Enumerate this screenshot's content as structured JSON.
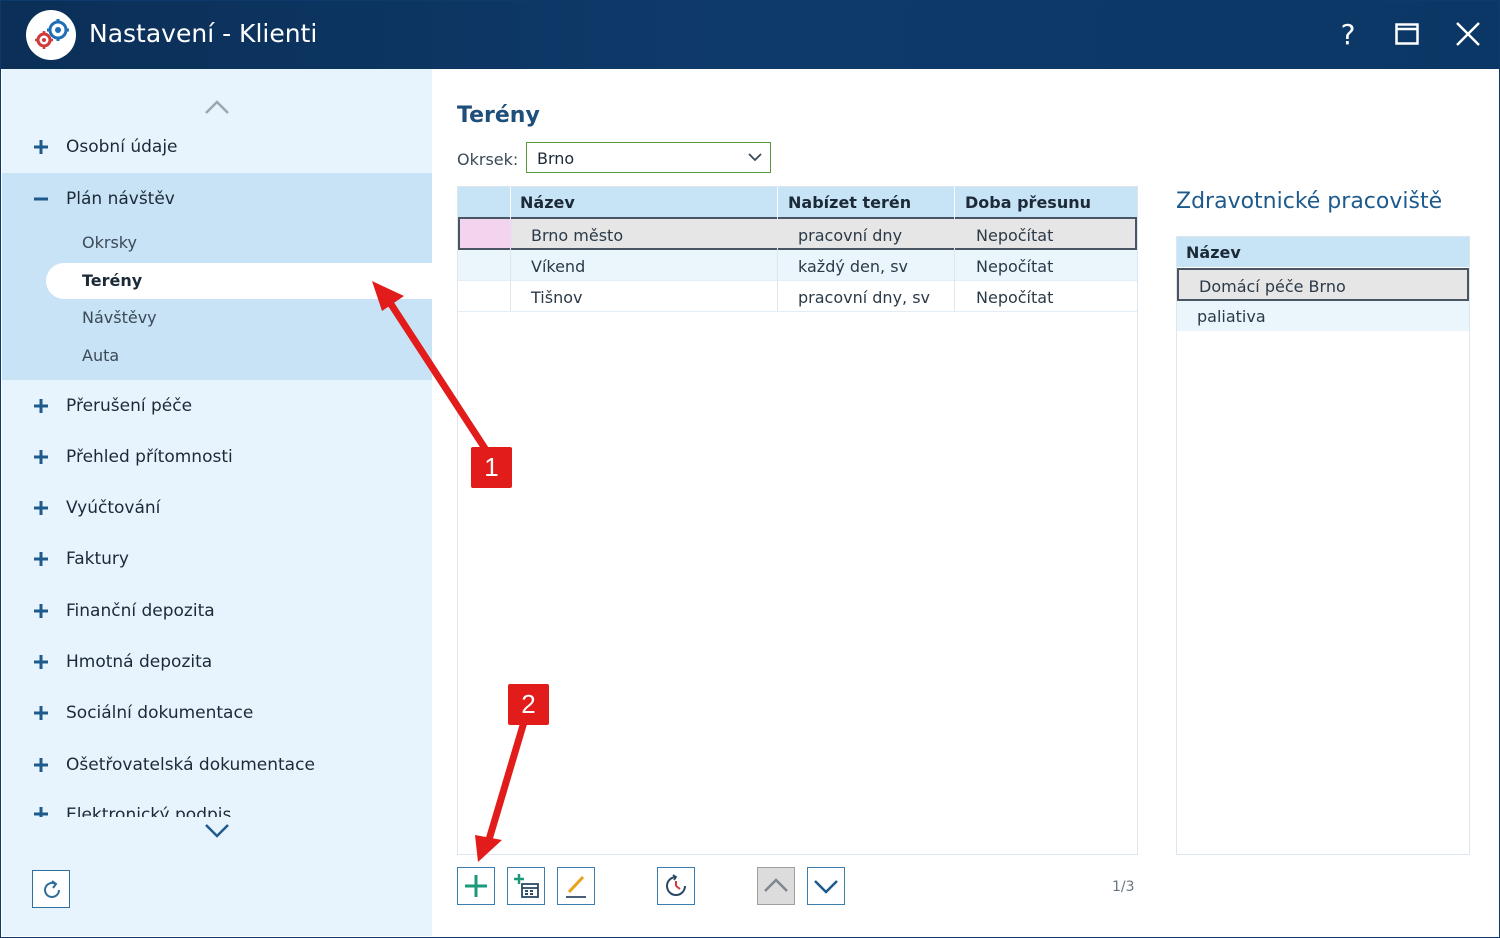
{
  "window": {
    "title": "Nastavení - Klienti",
    "help": "?"
  },
  "sidebar": {
    "items_top": [
      {
        "label": "Osobní údaje",
        "state": "collapsed"
      },
      {
        "label": "Plán návštěv",
        "state": "expanded"
      }
    ],
    "sub_items": [
      {
        "label": "Okrsky"
      },
      {
        "label": "Terény",
        "active": true
      },
      {
        "label": "Návštěvy"
      },
      {
        "label": "Auta"
      }
    ],
    "items_bottom": [
      {
        "label": "Přerušení péče"
      },
      {
        "label": "Přehled přítomnosti"
      },
      {
        "label": "Vyúčtování"
      },
      {
        "label": "Faktury"
      },
      {
        "label": "Finanční depozita"
      },
      {
        "label": "Hmotná depozita"
      },
      {
        "label": "Sociální dokumentace"
      },
      {
        "label": "Ošetřovatelská dokumentace"
      },
      {
        "label": "Elektronický podpis"
      }
    ]
  },
  "main": {
    "title": "Terény",
    "filter": {
      "label": "Okrsek:",
      "value": "Brno"
    },
    "grid": {
      "columns": [
        "Název",
        "Nabízet terén",
        "Doba přesunu"
      ],
      "rows": [
        {
          "name": "Brno město",
          "offer": "pracovní dny",
          "travel": "Nepočítat",
          "selected": true
        },
        {
          "name": "Víkend",
          "offer": "každý den, sv",
          "travel": "Nepočítat"
        },
        {
          "name": "Tišnov",
          "offer": "pracovní dny, sv",
          "travel": "Nepočítat"
        }
      ]
    },
    "pager": "1/3"
  },
  "side_panel": {
    "title": "Zdravotnické pracoviště",
    "column": "Název",
    "rows": [
      {
        "name": "Domácí péče Brno",
        "selected": true
      },
      {
        "name": "paliativa"
      }
    ]
  },
  "annotations": {
    "badge_1": "1",
    "badge_2": "2"
  },
  "toolbar": {
    "icons": [
      "plus-icon",
      "add-calendar-icon",
      "edit-pencil-icon",
      "history-clock-icon",
      "arrow-up-icon",
      "arrow-down-icon"
    ]
  },
  "colors": {
    "titlebar": "#0e3a6b",
    "sidebar_bg": "#e8f4fd",
    "sidebar_expanded": "#c8e3f5",
    "grid_header": "#c7e3f6",
    "accent": "#1e5a8c",
    "annotation": "#e21b1b"
  }
}
